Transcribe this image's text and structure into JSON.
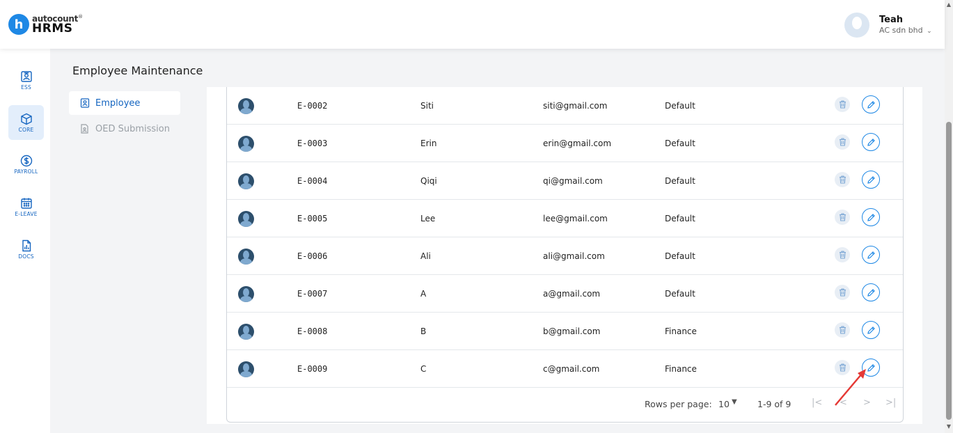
{
  "app": {
    "logo_letter": "h",
    "logo_top": "autocount",
    "logo_mark": "®",
    "logo_bottom": "HRMS"
  },
  "user": {
    "name": "Teah",
    "company": "AC sdn bhd",
    "chevron": "⌄"
  },
  "nav": [
    {
      "label": "ESS",
      "icon": "badge-icon"
    },
    {
      "label": "CORE",
      "icon": "cube-icon",
      "active": true
    },
    {
      "label": "PAYROLL",
      "icon": "dollar-icon"
    },
    {
      "label": "E-LEAVE",
      "icon": "calendar-icon"
    },
    {
      "label": "DOCS",
      "icon": "document-chart-icon"
    }
  ],
  "page": {
    "title": "Employee Maintenance"
  },
  "submenu": [
    {
      "label": "Employee",
      "active": true
    },
    {
      "label": "OED Submission",
      "active": false
    }
  ],
  "employees": [
    {
      "id": "E-0002",
      "name": "Siti",
      "email": "siti@gmail.com",
      "department": "Default"
    },
    {
      "id": "E-0003",
      "name": "Erin",
      "email": "erin@gmail.com",
      "department": "Default"
    },
    {
      "id": "E-0004",
      "name": "Qiqi",
      "email": "qi@gmail.com",
      "department": "Default"
    },
    {
      "id": "E-0005",
      "name": "Lee",
      "email": "lee@gmail.com",
      "department": "Default"
    },
    {
      "id": "E-0006",
      "name": "Ali",
      "email": "ali@gmail.com",
      "department": "Default"
    },
    {
      "id": "E-0007",
      "name": "A",
      "email": "a@gmail.com",
      "department": "Default"
    },
    {
      "id": "E-0008",
      "name": "B",
      "email": "b@gmail.com",
      "department": "Finance"
    },
    {
      "id": "E-0009",
      "name": "C",
      "email": "c@gmail.com",
      "department": "Finance"
    }
  ],
  "pagination": {
    "rows_per_page_label": "Rows per page:",
    "rows_per_page_value": "10",
    "range": "1-9 of 9",
    "first": "|<",
    "prev": "<",
    "next": ">",
    "last": ">|"
  },
  "colors": {
    "accent": "#1e88e5",
    "nav_active_bg": "#e3eefb",
    "annotation_arrow": "#e53935"
  }
}
